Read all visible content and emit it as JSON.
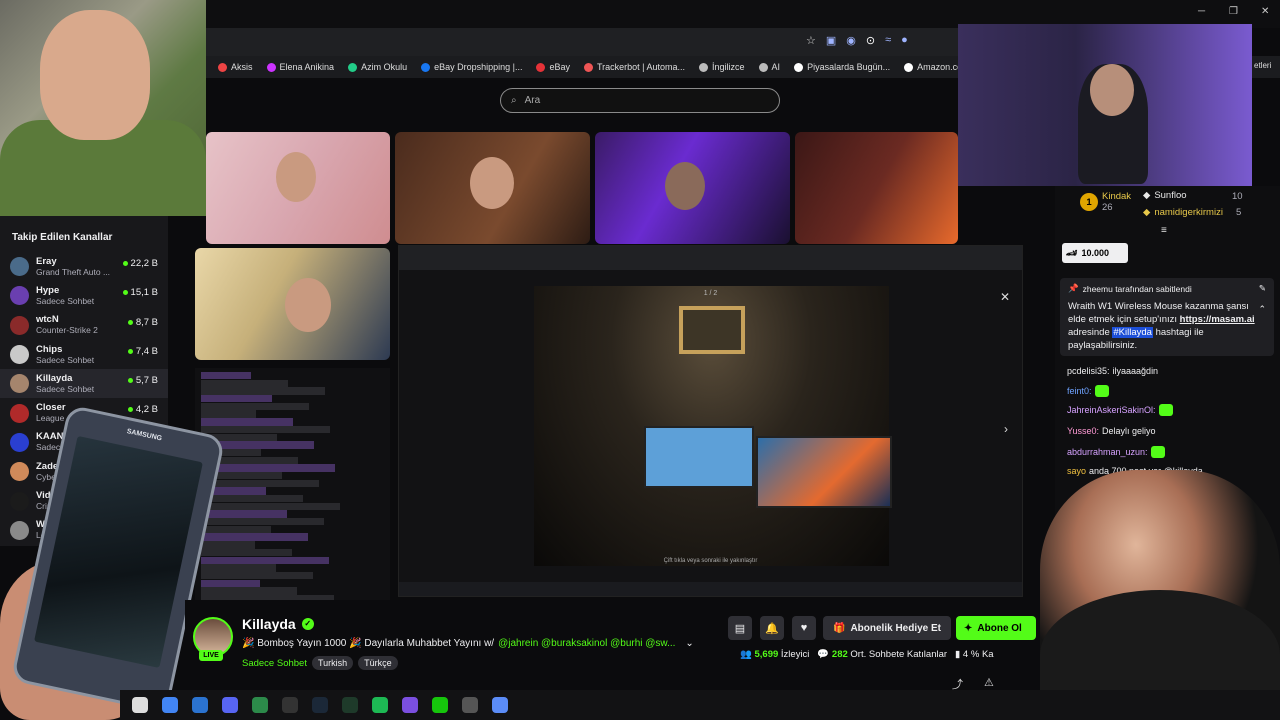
{
  "browser": {
    "search_placeholder": "Ara",
    "bookmarks": [
      {
        "label": "Aksis",
        "color": "#e44"
      },
      {
        "label": "Elena Anikina",
        "color": "#c3f"
      },
      {
        "label": "Azim Okulu",
        "color": "#2c8"
      },
      {
        "label": "eBay Dropshipping |...",
        "color": "#1877f2"
      },
      {
        "label": "eBay",
        "color": "#e53238"
      },
      {
        "label": "Trackerbot | Automa...",
        "color": "#e55"
      },
      {
        "label": "İngilizce",
        "color": "#bbb"
      },
      {
        "label": "AI",
        "color": "#bbb"
      },
      {
        "label": "Piyasalarda Bugün...",
        "color": "#fff"
      },
      {
        "label": "Amazon.com.tr: Elek...",
        "color": "#fff"
      }
    ],
    "bookmark_overflow": "etleri"
  },
  "sidebar": {
    "title": "Takip Edilen Kanallar",
    "channels": [
      {
        "name": "Eray",
        "category": "Grand Theft Auto ...",
        "viewers": "22,2 B",
        "live_color": "#53fc18",
        "avatar_color": "#4a6b8a"
      },
      {
        "name": "Hype",
        "category": "Sadece Sohbet",
        "viewers": "15,1 B",
        "live_color": "#53fc18",
        "avatar_color": "#6a3fb0"
      },
      {
        "name": "wtcN",
        "category": "Counter-Strike 2",
        "viewers": "8,7 B",
        "live_color": "#53fc18",
        "avatar_color": "#8a2a2a"
      },
      {
        "name": "Chips",
        "category": "Sadece Sohbet",
        "viewers": "7,4 B",
        "live_color": "#53fc18",
        "avatar_color": "#c9c9c9"
      },
      {
        "name": "Killayda",
        "category": "Sadece Sohbet",
        "viewers": "5,7 B",
        "live_color": "#53fc18",
        "avatar_color": "#a5856d"
      },
      {
        "name": "Closer",
        "category": "League of Legends",
        "viewers": "4,2 B",
        "live_color": "#53fc18",
        "avatar_color": "#b02a2a"
      },
      {
        "name": "KAANFLIX",
        "category": "Sadece Sohbet",
        "viewers": "",
        "live_color": "#53fc18",
        "avatar_color": "#2a3fd0"
      },
      {
        "name": "Zade",
        "category": "Cyberpunk 2077",
        "viewers": "",
        "live_color": "#53fc18",
        "avatar_color": "#d08a5a"
      },
      {
        "name": "Videoyun",
        "category": "Crimson Desert",
        "viewers": "",
        "live_color": "#53fc18",
        "avatar_color": "#1b1b1b"
      },
      {
        "name": "Wasabi",
        "category": "League of Legends",
        "viewers": "",
        "live_color": "#53fc18",
        "avatar_color": "#8a8a8a"
      }
    ]
  },
  "phone": {
    "brand": "SAMSUNG"
  },
  "video": {
    "pager": "1 / 2",
    "caption": "Çift tıkla veya sonraki ile yakınlaştır"
  },
  "stream": {
    "streamer": "Killayda",
    "live_label": "LIVE",
    "title_prefix": "🎉 Bomboş Yayın 1000 🎉 Dayılarla Muhabbet Yayını w/",
    "mentions": "@jahrein @buraksakinol @burhi @sw...",
    "category": "Sadece Sohbet",
    "tags": [
      "Turkish",
      "Türkçe"
    ],
    "gift_label": "Abonelik Hediye Et",
    "subscribe_label": "Abone Ol",
    "viewers": "5,699",
    "viewers_label": "İzleyici",
    "chatters": "282",
    "chatters_label": "Ort. Sohbete Katılanlar",
    "chat_percent": "4 %",
    "chat_percent_label": "Ka"
  },
  "chat": {
    "leaderboard": [
      {
        "rank": "1",
        "name": "Kindak",
        "value": "26"
      },
      {
        "rank": "",
        "name": "Sunfloo",
        "value": "10"
      },
      {
        "rank": "",
        "name": "namidigerkirmizi",
        "value": "5"
      }
    ],
    "kick_amount": "10.000",
    "pinned_by": "zheemu tarafından sabitlendi",
    "pinned_text_1": "Wraith W1 Wireless Mouse kazanma şansı elde etmek için setup'ınızı",
    "pinned_link": "https://masam.ai",
    "pinned_text_2": "adresinde",
    "pinned_hashtag": "#Killayda",
    "pinned_text_3": "hashtagi ile paylaşabilirsiniz.",
    "messages": [
      {
        "user": "pcdelisi35:",
        "text": "ilyaaaağdin",
        "color": "#efeff1"
      },
      {
        "user": "feint0:",
        "text": "",
        "color": "#6fa3ff"
      },
      {
        "user": "JahreinAskeriSakinOl:",
        "text": "",
        "color": "#d6a2ff"
      },
      {
        "user": "Yusse0:",
        "text": "Delaylı geliyo",
        "color": "#ff9ad5"
      },
      {
        "user": "abdurrahman_uzun:",
        "text": "",
        "color": "#d6a2ff"
      },
      {
        "user": "sayo",
        "text": "anda 700 post var @killayda",
        "color": "#f0c040"
      }
    ]
  },
  "colors": {
    "accent": "#53fc18",
    "background": "#0b0b0d"
  }
}
